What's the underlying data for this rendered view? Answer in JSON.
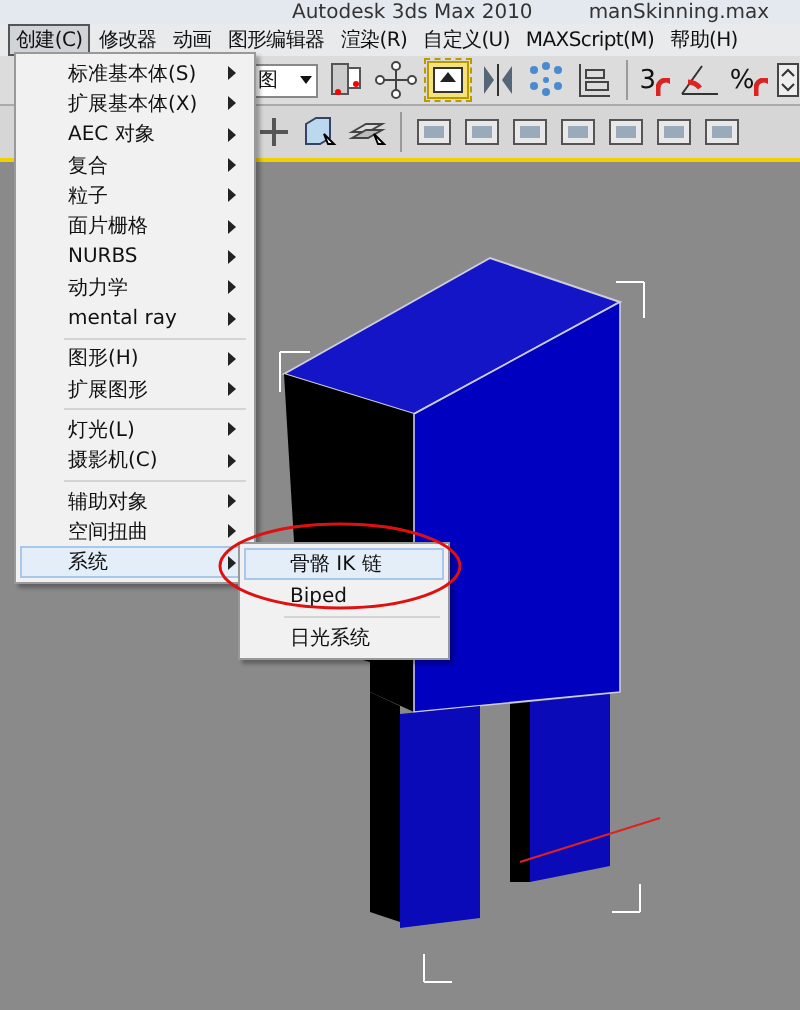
{
  "window": {
    "title": "Autodesk 3ds Max  2010",
    "file": "manSkinning.max"
  },
  "menu_bar": [
    {
      "label": "创建(C)",
      "selected": true
    },
    {
      "label": "修改器",
      "selected": false
    },
    {
      "label": "动画",
      "selected": false
    },
    {
      "label": "图形编辑器",
      "selected": false
    },
    {
      "label": "渲染(R)",
      "selected": false
    },
    {
      "label": "自定义(U)",
      "selected": false
    },
    {
      "label": "MAXScript(M)",
      "selected": false
    },
    {
      "label": "帮助(H)",
      "selected": false
    }
  ],
  "toolbar": {
    "dropdown": "图",
    "snap_labels": [
      "3",
      "%"
    ]
  },
  "create_menu": {
    "groups": [
      [
        {
          "label": "标准基本体(S)",
          "submenu": true,
          "selected": false
        },
        {
          "label": "扩展基本体(X)",
          "submenu": true,
          "selected": false
        },
        {
          "label": "AEC 对象",
          "submenu": true,
          "selected": false
        },
        {
          "label": "复合",
          "submenu": true,
          "selected": false
        },
        {
          "label": "粒子",
          "submenu": true,
          "selected": false
        },
        {
          "label": "面片栅格",
          "submenu": true,
          "selected": false
        },
        {
          "label": "NURBS",
          "submenu": true,
          "selected": false
        },
        {
          "label": "动力学",
          "submenu": true,
          "selected": false
        },
        {
          "label": "mental ray",
          "submenu": true,
          "selected": false
        }
      ],
      [
        {
          "label": "图形(H)",
          "submenu": true,
          "selected": false
        },
        {
          "label": "扩展图形",
          "submenu": true,
          "selected": false
        }
      ],
      [
        {
          "label": "灯光(L)",
          "submenu": true,
          "selected": false
        },
        {
          "label": "摄影机(C)",
          "submenu": true,
          "selected": false
        }
      ],
      [
        {
          "label": "辅助对象",
          "submenu": true,
          "selected": false
        },
        {
          "label": "空间扭曲",
          "submenu": true,
          "selected": false
        },
        {
          "label": "系统",
          "submenu": true,
          "selected": true
        }
      ]
    ]
  },
  "system_submenu": {
    "groups": [
      [
        {
          "label": "骨骼 IK 链",
          "selected": true
        },
        {
          "label": "Biped",
          "selected": false
        }
      ],
      [
        {
          "label": "日光系统",
          "selected": false
        }
      ]
    ]
  }
}
